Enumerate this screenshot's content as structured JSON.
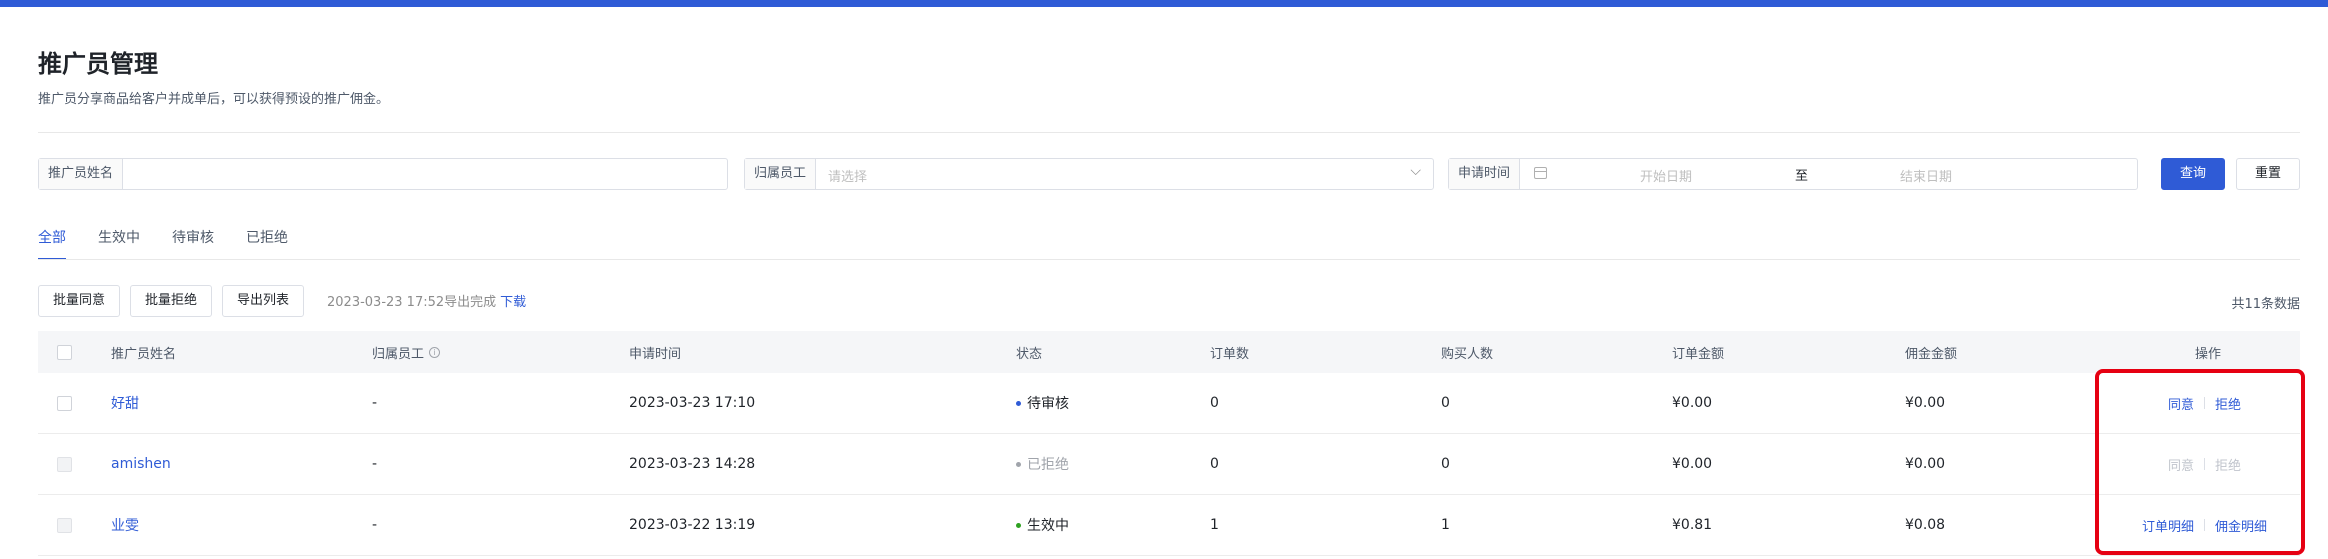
{
  "header": {
    "title": "推广员管理",
    "description": "推广员分享商品给客户并成单后，可以获得预设的推广佣金。"
  },
  "filters": {
    "name_label": "推广员姓名",
    "name_value": "",
    "staff_label": "归属员工",
    "staff_placeholder": "请选择",
    "date_label": "申请时间",
    "date_start_placeholder": "开始日期",
    "date_separator": "至",
    "date_end_placeholder": "结束日期",
    "search_button": "查询",
    "reset_button": "重置"
  },
  "tabs": [
    {
      "label": "全部",
      "active": true
    },
    {
      "label": "生效中",
      "active": false
    },
    {
      "label": "待审核",
      "active": false
    },
    {
      "label": "已拒绝",
      "active": false
    }
  ],
  "toolbar": {
    "batch_approve": "批量同意",
    "batch_reject": "批量拒绝",
    "export_list": "导出列表",
    "export_status": "2023-03-23 17:52导出完成",
    "download_link": "下载",
    "total": "共11条数据"
  },
  "table": {
    "columns": [
      "推广员姓名",
      "归属员工",
      "申请时间",
      "状态",
      "订单数",
      "购买人数",
      "订单金额",
      "佣金金额",
      "操作"
    ],
    "info_icon": "info-icon",
    "rows": [
      {
        "name": "好甜",
        "staff": "-",
        "time": "2023-03-23 17:10",
        "status": "待审核",
        "status_color": "#2f5bd6",
        "orders": "0",
        "buyers": "0",
        "order_amount": "¥0.00",
        "commission": "¥0.00",
        "actions": [
          "同意",
          "拒绝"
        ],
        "actions_enabled": true
      },
      {
        "name": "amishen",
        "staff": "-",
        "time": "2023-03-23 14:28",
        "status": "已拒绝",
        "status_color": "#a0a4ab",
        "orders": "0",
        "buyers": "0",
        "order_amount": "¥0.00",
        "commission": "¥0.00",
        "actions": [
          "同意",
          "拒绝"
        ],
        "actions_enabled": false
      },
      {
        "name": "业雯",
        "staff": "-",
        "time": "2023-03-22 13:19",
        "status": "生效中",
        "status_color": "#2ea121",
        "orders": "1",
        "buyers": "1",
        "order_amount": "¥0.81",
        "commission": "¥0.08",
        "actions": [
          "订单明细",
          "佣金明细"
        ],
        "actions_enabled": true
      }
    ]
  },
  "colors": {
    "accent": "#2f5bd6",
    "highlight_border": "#e60012"
  }
}
